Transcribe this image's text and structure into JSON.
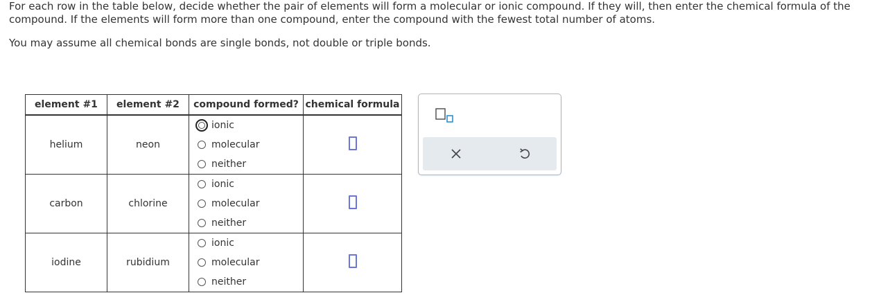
{
  "instructions": {
    "paragraph1": "For each row in the table below, decide whether the pair of elements will form a molecular or ionic compound. If they will, then enter the chemical formula of the compound. If the elements will form more than one compound, enter the compound with the fewest total number of atoms.",
    "paragraph2": "You may assume all chemical bonds are single bonds, not double or triple bonds."
  },
  "table": {
    "headers": {
      "element1": "element #1",
      "element2": "element #2",
      "compound": "compound formed?",
      "formula": "chemical formula"
    },
    "options": [
      "ionic",
      "molecular",
      "neither"
    ],
    "rows": [
      {
        "element1": "helium",
        "element2": "neon",
        "formula_value": "",
        "focused_option": "ionic"
      },
      {
        "element1": "carbon",
        "element2": "chlorine",
        "formula_value": ""
      },
      {
        "element1": "iodine",
        "element2": "rubidium",
        "formula_value": ""
      }
    ]
  },
  "tools": {
    "subscript_icon": "superscript-subscript-box-icon",
    "clear_icon": "x-icon",
    "undo_icon": "undo-arrow-icon",
    "accent_color": "#6a77d8",
    "bar_color": "#e5eaef"
  }
}
